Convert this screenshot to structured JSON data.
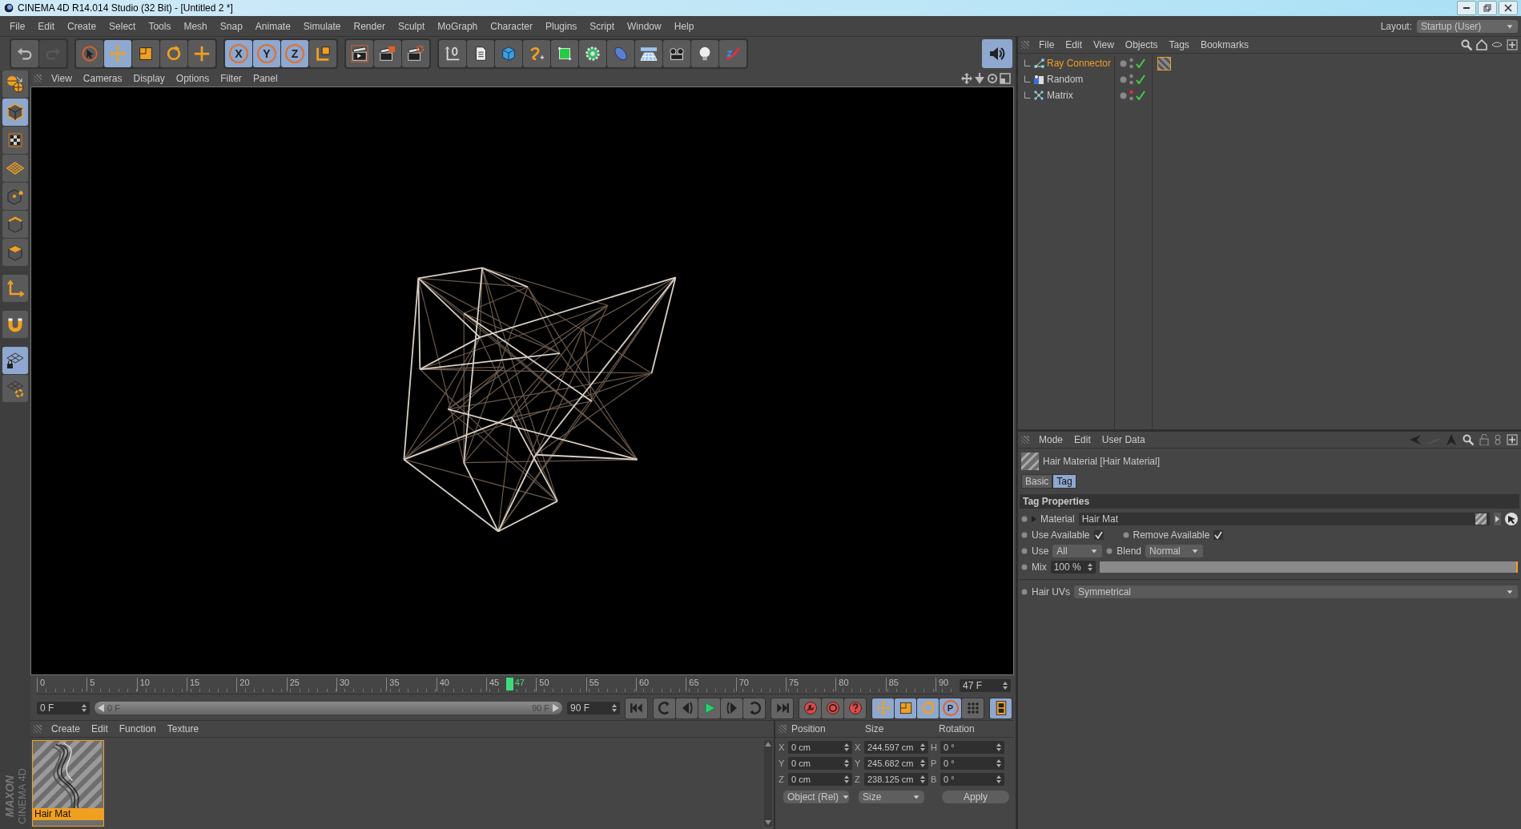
{
  "window": {
    "title": "CINEMA 4D R14.014 Studio (32 Bit) - [Untitled 2 *]"
  },
  "menu": [
    "File",
    "Edit",
    "Create",
    "Select",
    "Tools",
    "Mesh",
    "Snap",
    "Animate",
    "Simulate",
    "Render",
    "Sculpt",
    "MoGraph",
    "Character",
    "Plugins",
    "Script",
    "Window",
    "Help"
  ],
  "layout": {
    "label": "Layout:",
    "value": "Startup (User)"
  },
  "toolbar": [
    [
      {
        "selected": false,
        "disabled": false
      },
      {
        "selected": false,
        "disabled": true
      }
    ],
    [
      {
        "selected": false,
        "disabled": false
      },
      {
        "selected": true,
        "disabled": false
      },
      {
        "selected": false,
        "disabled": false
      },
      {
        "selected": false,
        "disabled": false
      },
      {
        "selected": false,
        "disabled": false
      }
    ],
    [
      {
        "label": "X",
        "selected": true,
        "disabled": false
      },
      {
        "label": "Y",
        "selected": true,
        "disabled": false
      },
      {
        "label": "Z",
        "selected": true,
        "disabled": false
      },
      {
        "selected": false,
        "disabled": false
      }
    ],
    [
      {
        "selected": false,
        "disabled": false
      },
      {
        "selected": false,
        "disabled": false
      },
      {
        "selected": false,
        "disabled": false
      }
    ],
    [
      {
        "selected": false,
        "disabled": false
      },
      {
        "selected": false,
        "disabled": false
      },
      {
        "selected": false,
        "disabled": false
      },
      {
        "selected": false,
        "disabled": false
      },
      {
        "selected": false,
        "disabled": false
      },
      {
        "selected": false,
        "disabled": false
      },
      {
        "selected": false,
        "disabled": false
      },
      {
        "selected": false,
        "disabled": false
      },
      {
        "selected": false,
        "disabled": false
      },
      {
        "selected": false,
        "disabled": false
      },
      {
        "selected": false,
        "disabled": false
      }
    ]
  ],
  "sound_button": {
    "selected": true
  },
  "left_tools": [
    {
      "selected": false
    },
    {
      "selected": true
    },
    {
      "selected": false
    },
    {
      "selected": false
    },
    {
      "selected": false
    },
    {
      "selected": false
    },
    {
      "selected": false
    },
    {
      "selected": false
    },
    {
      "selected": false
    },
    {
      "selected": true
    },
    {
      "selected": false
    }
  ],
  "viewport": {
    "menu": [
      "View",
      "Cameras",
      "Display",
      "Options",
      "Filter",
      "Panel"
    ]
  },
  "timeline": {
    "ticks": [
      "0",
      "5",
      "10",
      "15",
      "20",
      "25",
      "30",
      "35",
      "40",
      "45",
      "50",
      "55",
      "60",
      "65",
      "70",
      "75",
      "80",
      "85",
      "90"
    ],
    "current": "47",
    "level": 0.522,
    "frame": "47 F"
  },
  "range": {
    "start": "0 F",
    "slider_start": "0 F",
    "slider_end": "90 F",
    "end": "90 F",
    "level": 1
  },
  "playback": [
    {
      "selected": false
    },
    {
      "selected": false
    },
    {
      "selected": false
    },
    {
      "selected": false
    },
    {
      "selected": false
    },
    {
      "selected": false
    },
    {
      "selected": false
    }
  ],
  "keying": [
    {
      "selected": false
    },
    {
      "selected": false
    },
    {
      "selected": false
    },
    {
      "selected": true
    },
    {
      "selected": true
    },
    {
      "selected": true
    },
    {
      "label": "P",
      "selected": true
    },
    {
      "selected": false
    },
    {
      "selected": true
    }
  ],
  "material_manager": {
    "menu": [
      "Create",
      "Edit",
      "Function",
      "Texture"
    ],
    "materials": [
      {
        "name": "Hair Mat",
        "selected": true
      }
    ]
  },
  "coordinates": {
    "headers": [
      "Position",
      "Size",
      "Rotation"
    ],
    "rows": [
      {
        "axis": "X",
        "position": "0 cm",
        "size_axis": "X",
        "size": "244.597 cm",
        "rot_axis": "H",
        "rotation": "0 °"
      },
      {
        "axis": "Y",
        "position": "0 cm",
        "size_axis": "Y",
        "size": "245.682 cm",
        "rot_axis": "P",
        "rotation": "0 °"
      },
      {
        "axis": "Z",
        "position": "0 cm",
        "size_axis": "Z",
        "size": "238.125 cm",
        "rot_axis": "B",
        "rotation": "0 °"
      }
    ],
    "mode": "Object (Rel)",
    "size_mode": "Size",
    "apply": "Apply"
  },
  "object_manager": {
    "menu": [
      "File",
      "Edit",
      "View",
      "Objects",
      "Tags",
      "Bookmarks"
    ],
    "objects": [
      {
        "name": "Ray Connector",
        "selected": true,
        "editor_hidden": false,
        "enabled": true,
        "tags": [
          {
            "selected": true
          }
        ]
      },
      {
        "name": "Random",
        "selected": false,
        "editor_hidden": false,
        "enabled": true
      },
      {
        "name": "Matrix",
        "selected": false,
        "editor_hidden": true,
        "enabled": true
      }
    ]
  },
  "attributes": {
    "menu": [
      "Mode",
      "Edit",
      "User Data"
    ],
    "title": "Hair Material [Hair Material]",
    "tabs": [
      {
        "label": "Basic",
        "selected": false
      },
      {
        "label": "Tag",
        "selected": true
      }
    ],
    "section": "Tag Properties",
    "material": {
      "label": "Material",
      "value": "Hair Mat"
    },
    "use_available": {
      "label": "Use Available",
      "checked": true
    },
    "remove_available": {
      "label": "Remove Available",
      "checked": true
    },
    "use": {
      "label": "Use",
      "value": "All"
    },
    "blend": {
      "label": "Blend",
      "value": "Normal"
    },
    "mix": {
      "label": "Mix",
      "value": "100 %",
      "level": 1
    },
    "hair_uvs": {
      "label": "Hair UVs",
      "value": "Symmetrical"
    }
  },
  "logo": {
    "brand": "MAXON",
    "product": "CINEMA 4D"
  }
}
